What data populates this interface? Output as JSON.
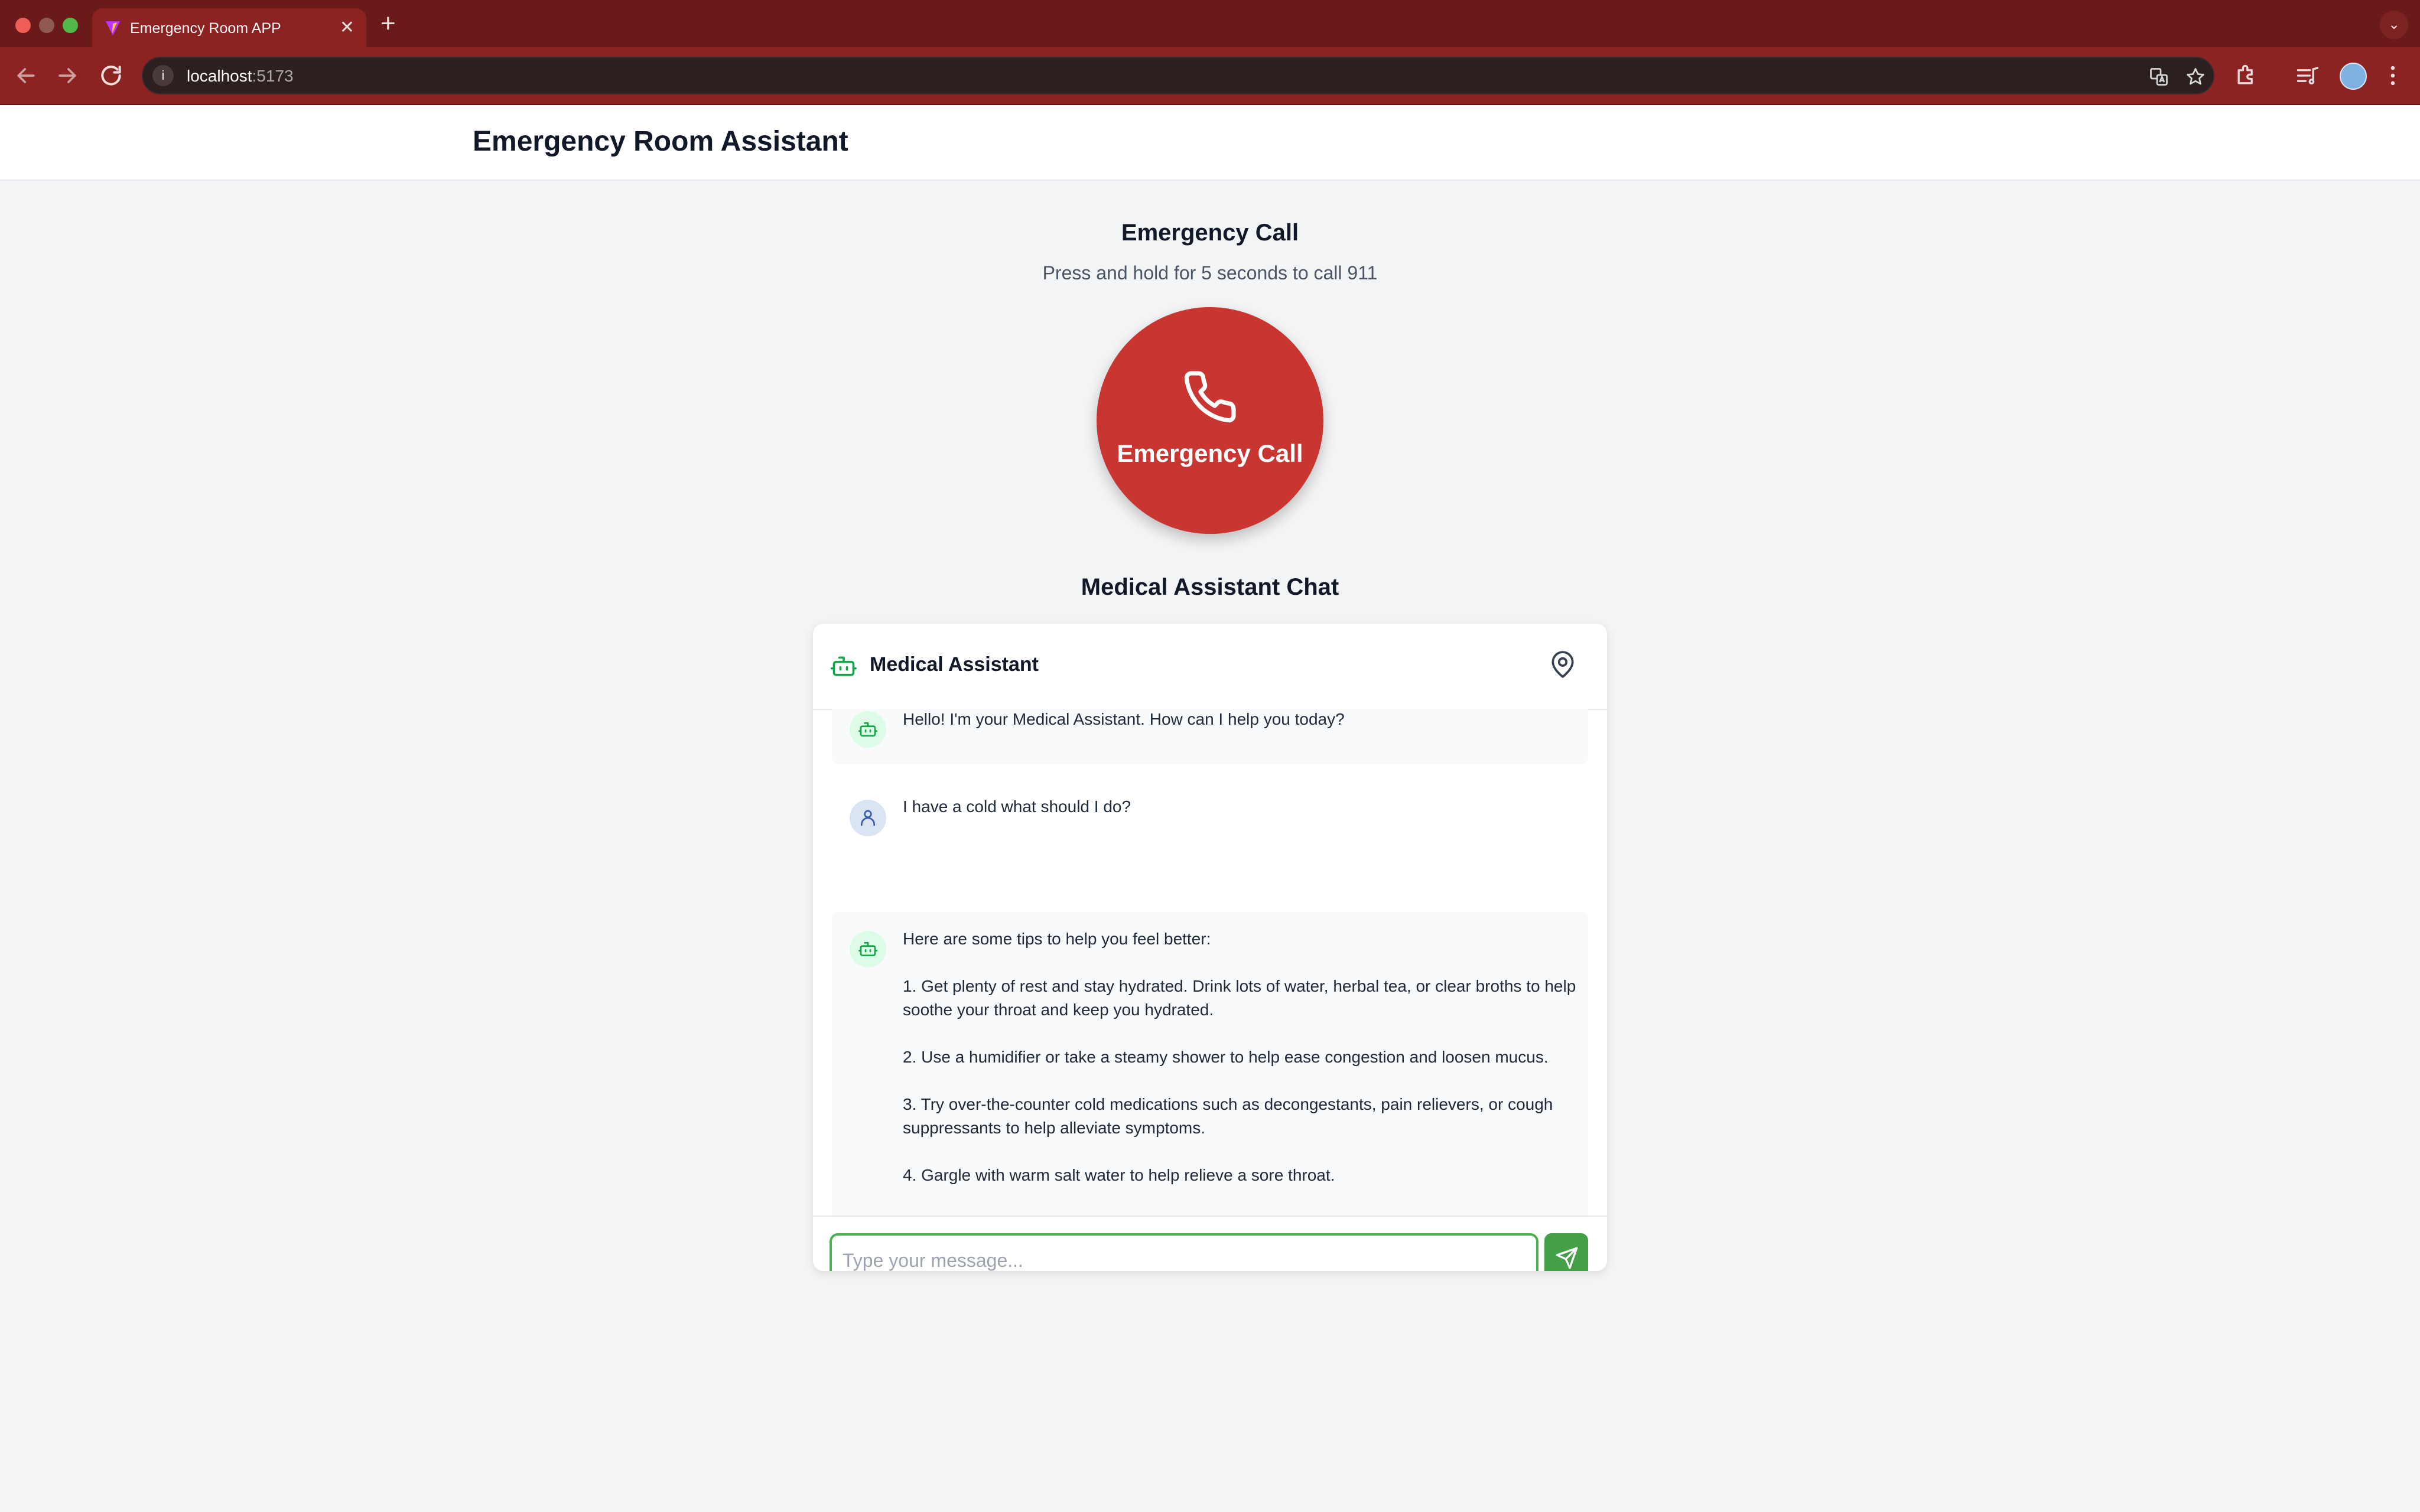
{
  "browser": {
    "tab_title": "Emergency Room APP",
    "url_host": "localhost",
    "url_port": ":5173"
  },
  "page": {
    "title": "Emergency Room Assistant"
  },
  "emergency": {
    "title": "Emergency Call",
    "subtitle": "Press and hold for 5 seconds to call 911",
    "button_label": "Emergency Call"
  },
  "chat": {
    "heading": "Medical Assistant Chat",
    "header_title": "Medical Assistant",
    "messages": [
      {
        "role": "bot",
        "lines": [
          "Hello! I'm your Medical Assistant. How can I help you today?"
        ]
      },
      {
        "role": "user",
        "lines": [
          "I have a cold what should I do?"
        ]
      },
      {
        "role": "bot",
        "lines": [
          "Here are some tips to help you feel better:",
          "1. Get plenty of rest and stay hydrated. Drink lots of water, herbal tea, or clear broths to help soothe your throat and keep you hydrated.",
          "2. Use a humidifier or take a steamy shower to help ease congestion and loosen mucus.",
          "3. Try over-the-counter cold medications such as decongestants, pain relievers, or cough suppressants to help alleviate symptoms.",
          "4. Gargle with warm salt water to help relieve a sore throat."
        ]
      }
    ],
    "input_value": "",
    "input_placeholder": "Type your message..."
  },
  "colors": {
    "emergency_red": "#c93530",
    "accent_green": "#43a047",
    "browser_tab_red": "#6b1a1a"
  },
  "icons": {
    "call": "phone-icon",
    "bot": "robot-icon",
    "user": "user-icon",
    "location": "map-pin-icon",
    "send": "send-icon"
  }
}
